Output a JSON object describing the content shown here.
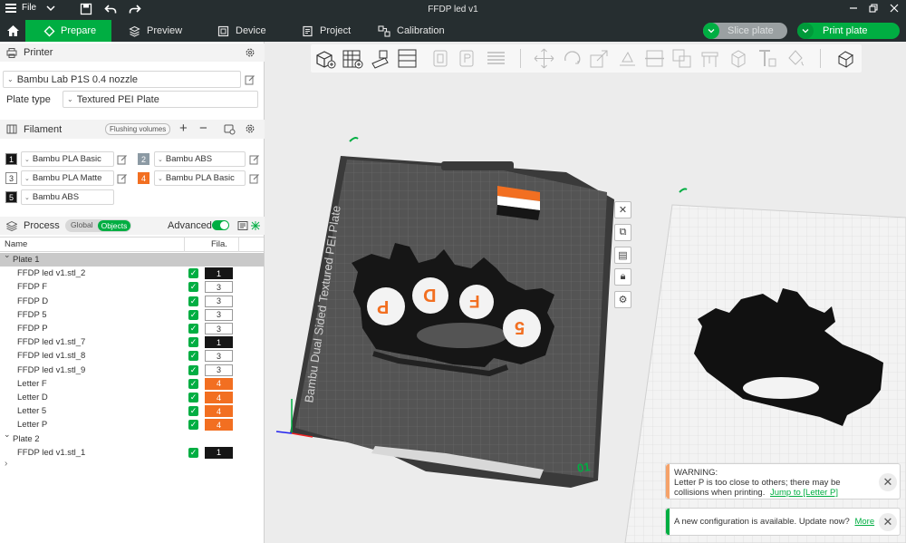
{
  "window": {
    "title": "FFDP led v1",
    "file_label": "File"
  },
  "tabs": [
    {
      "label": "Prepare"
    },
    {
      "label": "Preview"
    },
    {
      "label": "Device"
    },
    {
      "label": "Project"
    },
    {
      "label": "Calibration"
    }
  ],
  "actions": {
    "slice_label": "Slice plate",
    "print_label": "Print plate"
  },
  "printer": {
    "section_title": "Printer",
    "model": "Bambu Lab P1S 0.4 nozzle",
    "plate_type_label": "Plate type",
    "plate_type_value": "Textured PEI Plate"
  },
  "filament": {
    "section_title": "Filament",
    "flushing_label": "Flushing volumes",
    "slots": [
      {
        "num": "1",
        "name": "Bambu PLA Basic",
        "color": "#161616"
      },
      {
        "num": "2",
        "name": "Bambu ABS",
        "color": "#8c9aa4"
      },
      {
        "num": "3",
        "name": "Bambu PLA Matte",
        "color": "#ffffff"
      },
      {
        "num": "4",
        "name": "Bambu PLA Basic",
        "color": "#f26f21"
      },
      {
        "num": "5",
        "name": "Bambu ABS",
        "color": "#161616"
      }
    ]
  },
  "process": {
    "section_title": "Process",
    "toggle_global": "Global",
    "toggle_objects": "Objects",
    "advanced_label": "Advanced"
  },
  "objects": {
    "col_name": "Name",
    "col_fila": "Fila.",
    "plates": [
      {
        "label": "Plate 1",
        "items": [
          {
            "name": "FFDP led v1.stl_2",
            "fila": "1"
          },
          {
            "name": "FFDP F",
            "fila": "3"
          },
          {
            "name": "FFDP D",
            "fila": "3"
          },
          {
            "name": "FFDP 5",
            "fila": "3"
          },
          {
            "name": "FFDP P",
            "fila": "3"
          },
          {
            "name": "FFDP led v1.stl_7",
            "fila": "1"
          },
          {
            "name": "FFDP led v1.stl_8",
            "fila": "3"
          },
          {
            "name": "FFDP led v1.stl_9",
            "fila": "3"
          },
          {
            "name": "Letter F",
            "fila": "4"
          },
          {
            "name": "Letter D",
            "fila": "4"
          },
          {
            "name": "Letter 5",
            "fila": "4"
          },
          {
            "name": "Letter P",
            "fila": "4"
          }
        ]
      },
      {
        "label": "Plate 2",
        "items": [
          {
            "name": "FFDP led v1.stl_1",
            "fila": "1"
          }
        ]
      }
    ]
  },
  "viewport": {
    "plate_text": "Bambu Dual Sided Textured PEI Plate",
    "plate_number": "01",
    "letters": [
      "P",
      "D",
      "F",
      "5"
    ]
  },
  "notifications": {
    "warning_title": "WARNING:",
    "warning_text": "Letter P is too close to others; there may be collisions when printing.",
    "warning_link": "Jump to [Letter P]",
    "config_text": "A new configuration is available. Update now?",
    "config_link": "More"
  },
  "colors": {
    "accent": "#00ae42",
    "topbar": "#262e30",
    "orange": "#f26f21",
    "black_filament": "#161616"
  }
}
